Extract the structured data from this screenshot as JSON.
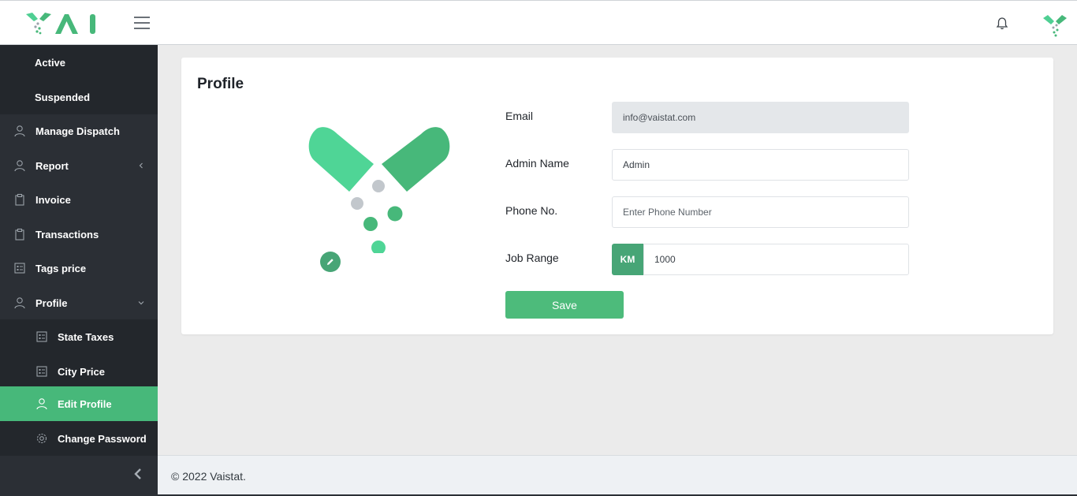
{
  "colors": {
    "accent": "#47b87a",
    "accent_dark": "#47a576",
    "sidebar_bg": "#2b2f35"
  },
  "header": {
    "menu_icon": "hamburger-icon",
    "notification_icon": "bell-icon",
    "avatar_icon": "brand-mark-icon"
  },
  "sidebar": {
    "items": [
      {
        "label": "Active",
        "icon": ""
      },
      {
        "label": "Suspended",
        "icon": ""
      },
      {
        "label": "Manage Dispatch",
        "icon": "user-icon"
      },
      {
        "label": "Report",
        "icon": "user-icon",
        "caret": "chevron-left-icon"
      },
      {
        "label": "Invoice",
        "icon": "clipboard-icon"
      },
      {
        "label": "Transactions",
        "icon": "clipboard-icon"
      },
      {
        "label": "Tags price",
        "icon": "list-icon"
      },
      {
        "label": "Profile",
        "icon": "user-icon",
        "caret": "chevron-down-icon"
      },
      {
        "label": "State Taxes",
        "icon": "list-icon"
      },
      {
        "label": "City Price",
        "icon": "list-icon"
      },
      {
        "label": "Edit Profile",
        "icon": "user-icon",
        "active": true
      },
      {
        "label": "Change Password",
        "icon": "gear-icon"
      }
    ],
    "collapse_icon": "chevron-left-icon"
  },
  "profile": {
    "title": "Profile",
    "email_label": "Email",
    "email_value": "info@vaistat.com",
    "admin_name_label": "Admin Name",
    "admin_name_value": "Admin",
    "phone_label": "Phone No.",
    "phone_placeholder": "Enter Phone Number",
    "job_range_label": "Job Range",
    "job_range_unit": "KM",
    "job_range_value": "1000",
    "save_label": "Save"
  },
  "footer": {
    "text": "© 2022 Vaistat."
  }
}
